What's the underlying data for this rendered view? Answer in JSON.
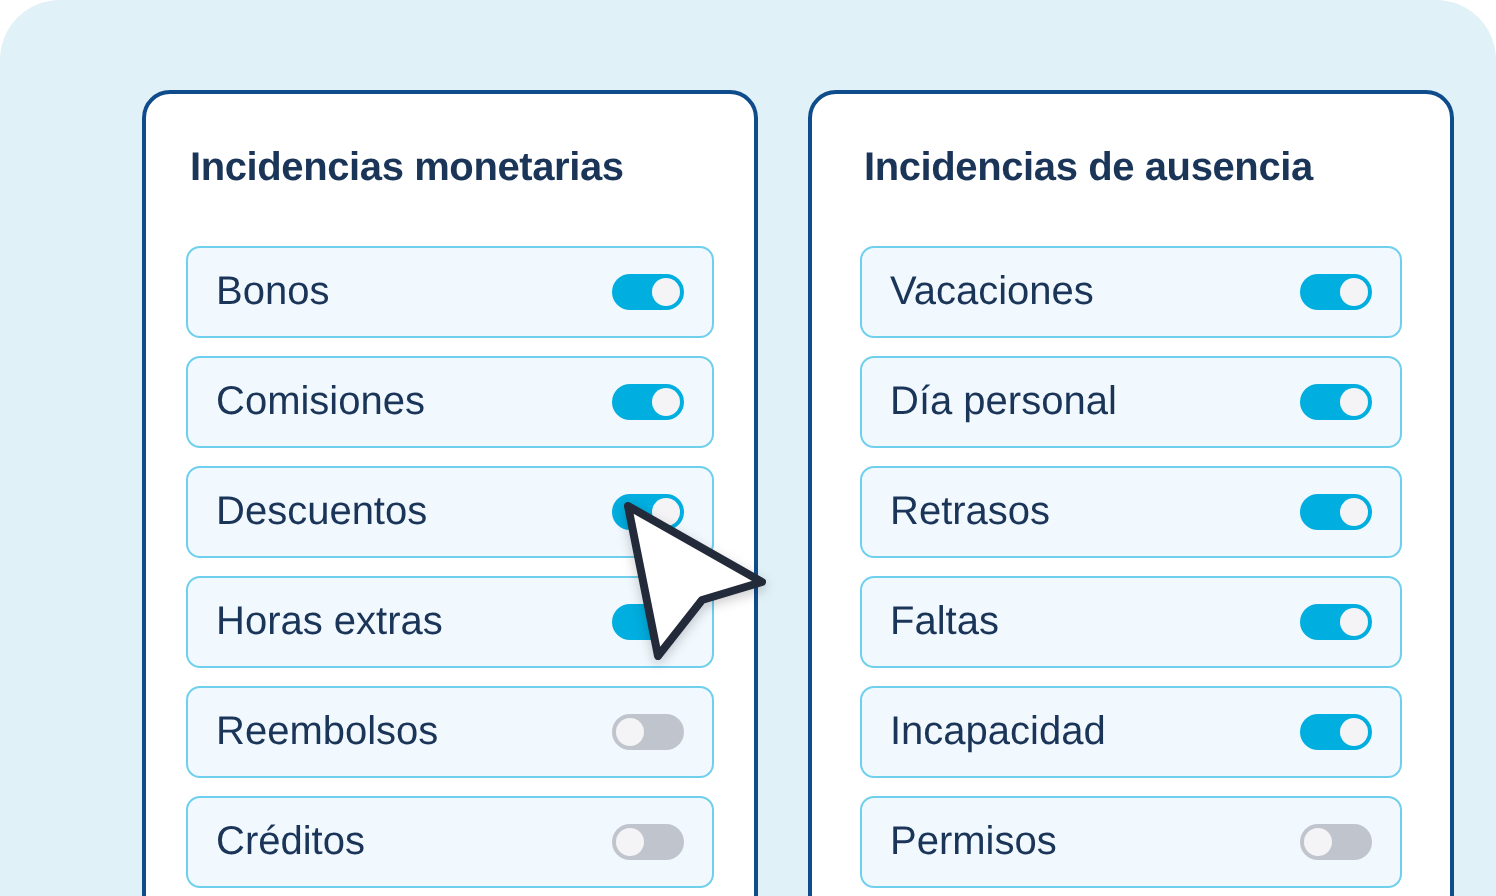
{
  "panels": [
    {
      "title": "Incidencias monetarias",
      "items": [
        {
          "label": "Bonos",
          "on": true
        },
        {
          "label": "Comisiones",
          "on": true
        },
        {
          "label": "Descuentos",
          "on": true
        },
        {
          "label": "Horas extras",
          "on": true
        },
        {
          "label": "Reembolsos",
          "on": false
        },
        {
          "label": "Créditos",
          "on": false
        }
      ]
    },
    {
      "title": "Incidencias de ausencia",
      "items": [
        {
          "label": "Vacaciones",
          "on": true
        },
        {
          "label": "Día personal",
          "on": true
        },
        {
          "label": "Retrasos",
          "on": true
        },
        {
          "label": "Faltas",
          "on": true
        },
        {
          "label": "Incapacidad",
          "on": true
        },
        {
          "label": "Permisos",
          "on": false
        }
      ]
    }
  ]
}
